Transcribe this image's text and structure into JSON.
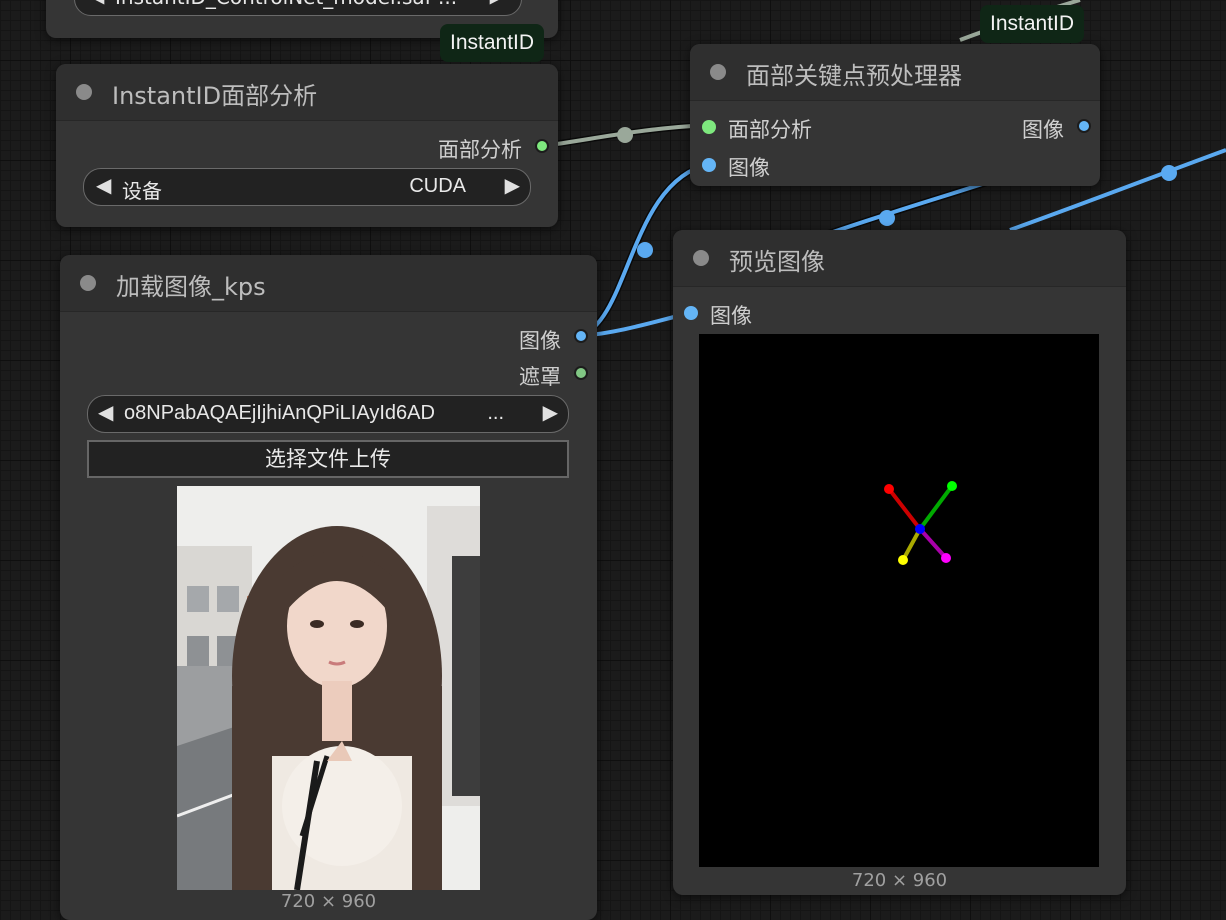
{
  "top_node": {
    "model_select": "InstantID_ControlNet_model.saf ...",
    "badge": "InstantID"
  },
  "badge_top_right": "InstantID",
  "face_analysis_node": {
    "title": "InstantID面部分析",
    "output_label": "面部分析",
    "device_label": "设备",
    "device_value": "CUDA"
  },
  "keypoint_node": {
    "title": "面部关键点预处理器",
    "input_face": "面部分析",
    "input_image": "图像",
    "output_image": "图像"
  },
  "load_image_node": {
    "title": "加载图像_kps",
    "output_image": "图像",
    "output_mask": "遮罩",
    "filename": "o8NPabAQAEjIjhiAnQPiLIAyId6AD",
    "filename_ellipsis": "...",
    "upload_label": "选择文件上传",
    "dimensions": "720 × 960"
  },
  "preview_node": {
    "title": "预览图像",
    "input_image": "图像",
    "dimensions": "720 × 960"
  },
  "colors": {
    "face_analysis_slot": "#7ee87e",
    "image_slot": "#64b5f6",
    "mask_slot": "#81c784",
    "image_wire": "#5aa9f0",
    "face_wire": "#9aa89a",
    "keypoints": [
      "#ff0000",
      "#00cc00",
      "#0000ff",
      "#ffff00",
      "#ff00ff"
    ]
  }
}
